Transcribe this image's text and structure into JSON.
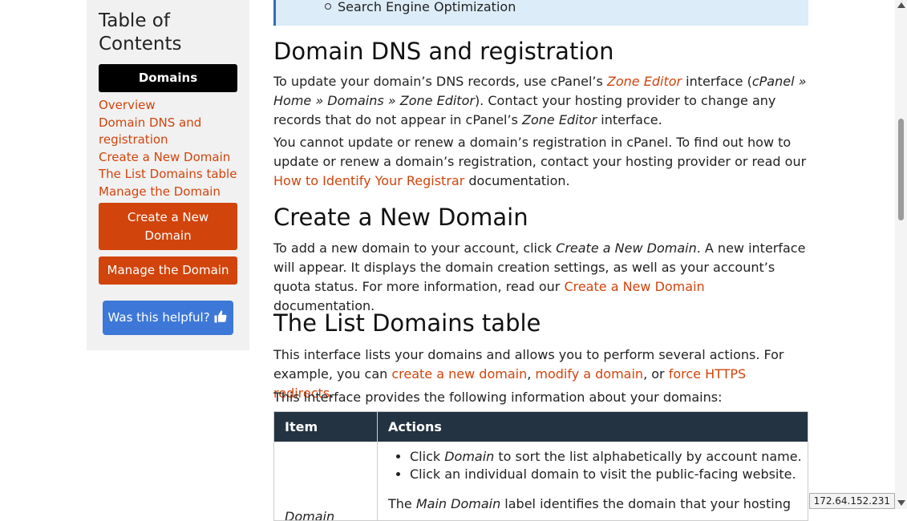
{
  "toc": {
    "title_line1": "Table of",
    "title_line2": "Contents",
    "current": "Domains",
    "links": [
      "Overview",
      "Domain DNS and",
      "registration",
      "Create a New Domain",
      "The List Domains table",
      "Manage the Domain"
    ],
    "button_create_line1": "Create a New",
    "button_create_line2": "Domain",
    "button_manage": "Manage the Domain",
    "helpful": "Was this helpful?",
    "helpful_icon": "thumbs-up-icon"
  },
  "callout": {
    "item": "Search Engine Optimization"
  },
  "sections": {
    "dns": {
      "heading": "Domain DNS and registration",
      "p1_a": "To update your domain’s DNS records, use cPanel’s ",
      "p1_link": "Zone Editor",
      "p1_b": " interface (",
      "p1_path": "cPanel » Home » Domains » Zone Editor",
      "p1_c": "). Contact your hosting provider to change any records that do not appear in cPanel’s ",
      "p1_em": "Zone Editor",
      "p1_d": " interface.",
      "p2_a": "You cannot update or renew a domain’s registration in cPanel. To find out how to update or renew a domain’s registration, contact your hosting provider or read our ",
      "p2_link": "How to Identify Your Registrar",
      "p2_b": " documentation."
    },
    "create": {
      "heading": "Create a New Domain",
      "p_a": "To add a new domain to your account, click ",
      "p_em": "Create a New Domain",
      "p_b": ". A new interface will appear. It displays the domain creation settings, as well as your account’s quota status. For more information, read our ",
      "p_link": "Create a New Domain",
      "p_c": " documentation."
    },
    "list": {
      "heading": "The List Domains table",
      "p1_a": "This interface lists your domains and allows you to perform several actions. For example, you can ",
      "p1_link1": "create a new domain",
      "p1_sep1": ", ",
      "p1_link2": "modify a domain",
      "p1_sep2": ", or ",
      "p1_link3": "force HTTPS redirects",
      "p1_end": ".",
      "p2": "This interface provides the following information about your domains:"
    }
  },
  "table": {
    "headers": [
      "Item",
      "Actions"
    ],
    "row1_item": "Domain",
    "bullet1_a": "Click ",
    "bullet1_em": "Domain",
    "bullet1_b": " to sort the list alphabetically by account name.",
    "bullet2": "Click an individual domain to visit the public-facing website.",
    "note_a": "The ",
    "note_em": "Main Domain",
    "note_b": " label identifies the domain that your hosting"
  },
  "status": {
    "ip": "172.64.152.231"
  }
}
